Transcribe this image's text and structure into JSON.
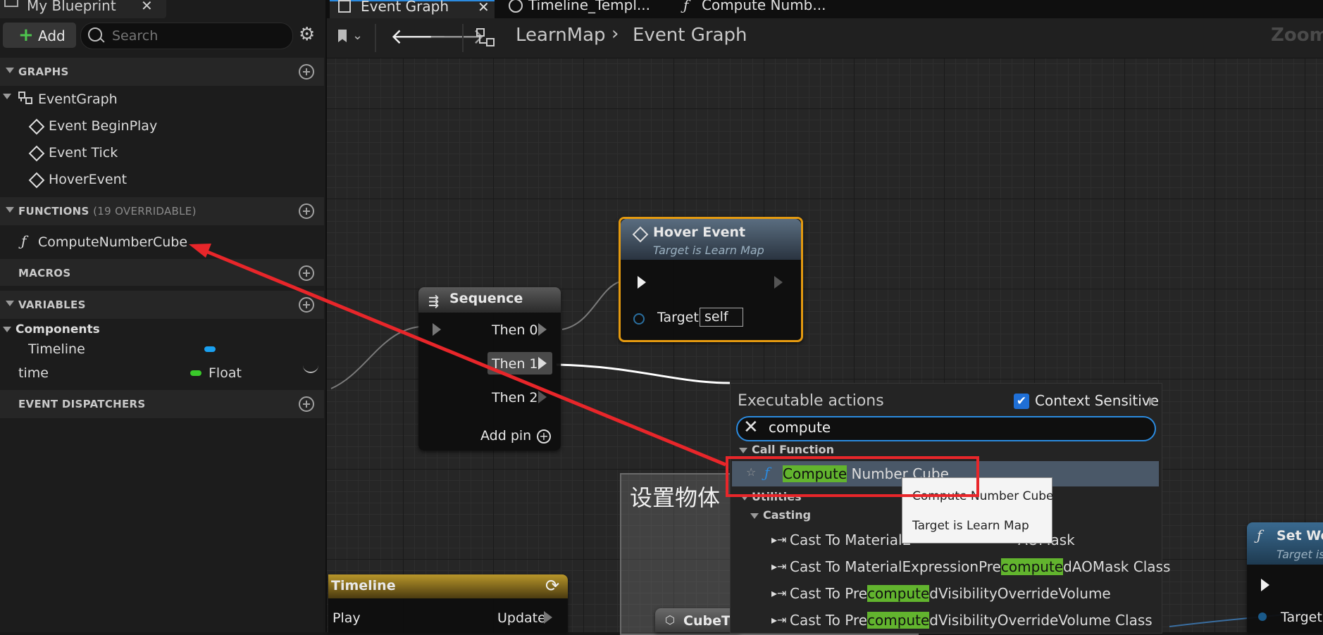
{
  "left_panel": {
    "tab_title": "My Blueprint",
    "tab_close": "✕",
    "add_label": "Add",
    "search_placeholder": "Search",
    "sections": {
      "graphs": {
        "title": "GRAPHS"
      },
      "functions": {
        "title": "FUNCTIONS",
        "subtitle": "(19 OVERRIDABLE)"
      },
      "macros": {
        "title": "MACROS"
      },
      "variables": {
        "title": "VARIABLES"
      },
      "dispatchers": {
        "title": "EVENT DISPATCHERS"
      }
    },
    "graph_root": "EventGraph",
    "events": [
      "Event BeginPlay",
      "Event Tick",
      "HoverEvent"
    ],
    "function_item": "ComputeNumberCube",
    "components_label": "Components",
    "variables": [
      {
        "name": "Timeline",
        "type": "",
        "color": "#1aa0f0"
      },
      {
        "name": "time",
        "type": "Float",
        "color": "#39c92a"
      }
    ]
  },
  "tabs": [
    {
      "label": "Event Graph",
      "close": "✕"
    },
    {
      "label": "Timeline_Templ..."
    },
    {
      "label": "Compute Numb..."
    }
  ],
  "toolbar": {
    "breadcrumb_root": "LearnMap",
    "breadcrumb_sep": "›",
    "breadcrumb_current": "Event Graph",
    "zoom_label": "Zoom"
  },
  "nodes": {
    "hover_event": {
      "title": "Hover Event",
      "subtitle": "Target is Learn Map",
      "target_label": "Target",
      "target_value": "self"
    },
    "sequence": {
      "title": "Sequence",
      "pins": [
        "Then 0",
        "Then 1",
        "Then 2"
      ],
      "add_pin": "Add pin"
    },
    "timeline": {
      "title": "Timeline",
      "play": "Play",
      "update": "Update"
    },
    "cube": {
      "title": "CubeTi"
    },
    "comment": {
      "title": "设置物体"
    },
    "set_world": {
      "title": "Set Wor",
      "subtitle": "Target is",
      "target_label": "Target"
    }
  },
  "actions_menu": {
    "title": "Executable actions",
    "context_label": "Context Sensitive",
    "search_value": "compute",
    "categories": {
      "call_function": "Call Function",
      "utilities": "Utilities",
      "casting": "Casting"
    },
    "selected": {
      "highlight": "Compute",
      "rest": " Number Cube"
    },
    "cast_items": [
      {
        "pre": "Cast To MaterialE",
        "hl": "",
        "post": "AOMask"
      },
      {
        "pre": "Cast To MaterialExpressionPre",
        "hl": "compute",
        "post": "dAOMask Class"
      },
      {
        "pre": "Cast To Pre",
        "hl": "compute",
        "post": "dVisibilityOverrideVolume"
      },
      {
        "pre": "Cast To Pre",
        "hl": "compute",
        "post": "dVisibilityOverrideVolume Class"
      }
    ]
  },
  "tooltip": {
    "line1": "Compute Number Cube",
    "line2": "Target is Learn Map"
  },
  "colors": {
    "annotation_red": "#e8262a",
    "highlight_green": "#62b42e",
    "accent_blue": "#2b8be0"
  }
}
